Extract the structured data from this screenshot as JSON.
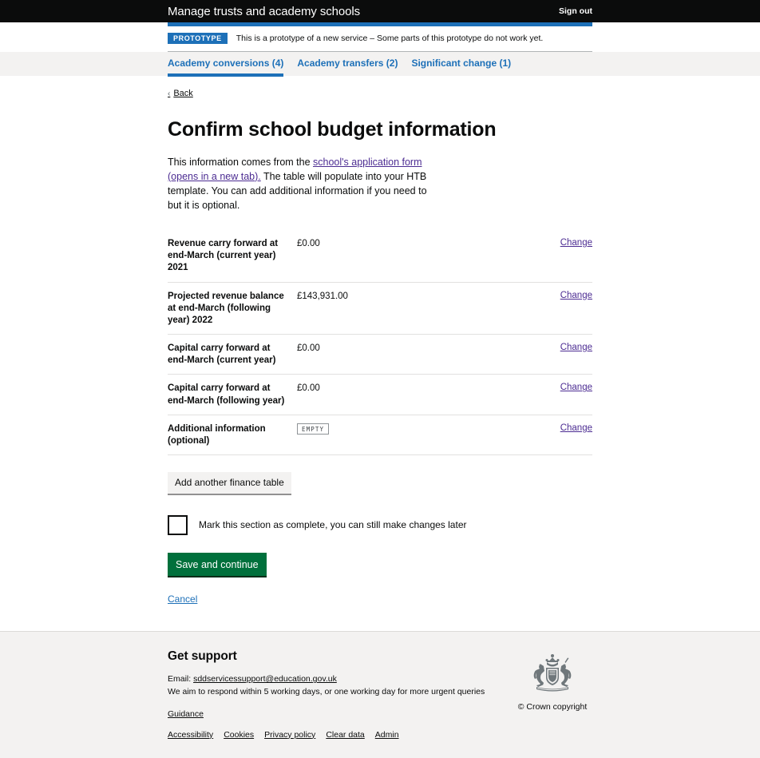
{
  "header": {
    "title": "Manage trusts and academy schools",
    "sign_out_label": "Sign out"
  },
  "phase_banner": {
    "tag": "PROTOTYPE",
    "text": "This is a prototype of a new service – Some parts of this prototype do not work yet."
  },
  "tabs": [
    {
      "label": "Academy conversions (4)",
      "active": true
    },
    {
      "label": "Academy transfers (2)",
      "active": false
    },
    {
      "label": "Significant change (1)",
      "active": false
    }
  ],
  "main": {
    "back_label": "Back",
    "back_chevron": "‹",
    "page_title": "Confirm school budget information",
    "intro_before": "This information comes from the ",
    "intro_link": "school's application form (opens in a new tab).",
    "intro_after": " The table will populate into your HTB template. You can add additional information if you need to but it is optional.",
    "change_label": "Change",
    "rows": [
      {
        "key": "Revenue carry forward at end-March (current year) 2021",
        "value": "£0.00",
        "action": "Change",
        "is_tag": false
      },
      {
        "key": "Projected revenue balance at end-March (following year) 2022",
        "value": "£143,931.00",
        "action": "Change",
        "is_tag": false
      },
      {
        "key": "Capital carry forward at end-March (current year)",
        "value": "£0.00",
        "action": "Change",
        "is_tag": false
      },
      {
        "key": "Capital carry forward at end-March (following year)",
        "value": "£0.00",
        "action": "Change",
        "is_tag": false
      },
      {
        "key": "Additional information (optional)",
        "value": "EMPTY",
        "action": "Change",
        "is_tag": true
      }
    ],
    "add_table_button": "Add another finance table",
    "checkbox_label": "Mark this section as complete, you can still make changes later",
    "checkbox_checked": false,
    "save_button": "Save and continue",
    "cancel_label": "Cancel"
  },
  "footer": {
    "title": "Get support",
    "email_prefix": "Email: ",
    "email": "sddservicessupport@education.gov.uk",
    "response_text": "We aim to respond within 5 working days, or one working day for more urgent queries",
    "guidance_label": "Guidance",
    "links": [
      {
        "label": "Accessibility"
      },
      {
        "label": "Cookies"
      },
      {
        "label": "Privacy policy"
      },
      {
        "label": "Clear data"
      },
      {
        "label": "Admin"
      }
    ],
    "crown_caption": "© Crown copyright"
  },
  "colors": {
    "header_black": "#0b0c0c",
    "brand_blue": "#1d70b8",
    "link_visited": "#4c2c92",
    "button_green": "#00703c",
    "grey_band": "#f3f2f1"
  }
}
